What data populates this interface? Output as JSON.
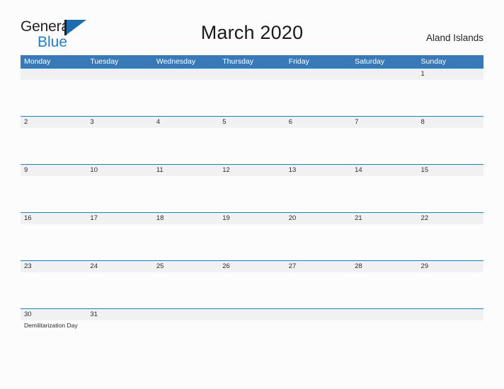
{
  "brand": {
    "name_top": "General",
    "name_bottom": "Blue",
    "triangle_color": "#1e6cb0",
    "blue_text_color": "#1b7fd4"
  },
  "header": {
    "title": "March 2020",
    "locale": "Aland Islands"
  },
  "theme": {
    "header_blue": "#3a79b8",
    "row_line_blue": "#3a79b8",
    "daynum_band_gray": "#f1f1f1",
    "page_background": "#fcfcfc"
  },
  "calendar": {
    "weekday_headers": [
      "Monday",
      "Tuesday",
      "Wednesday",
      "Thursday",
      "Friday",
      "Saturday",
      "Sunday"
    ],
    "weeks": [
      [
        {
          "day": "",
          "event": ""
        },
        {
          "day": "",
          "event": ""
        },
        {
          "day": "",
          "event": ""
        },
        {
          "day": "",
          "event": ""
        },
        {
          "day": "",
          "event": ""
        },
        {
          "day": "",
          "event": ""
        },
        {
          "day": "1",
          "event": ""
        }
      ],
      [
        {
          "day": "2",
          "event": ""
        },
        {
          "day": "3",
          "event": ""
        },
        {
          "day": "4",
          "event": ""
        },
        {
          "day": "5",
          "event": ""
        },
        {
          "day": "6",
          "event": ""
        },
        {
          "day": "7",
          "event": ""
        },
        {
          "day": "8",
          "event": ""
        }
      ],
      [
        {
          "day": "9",
          "event": ""
        },
        {
          "day": "10",
          "event": ""
        },
        {
          "day": "11",
          "event": ""
        },
        {
          "day": "12",
          "event": ""
        },
        {
          "day": "13",
          "event": ""
        },
        {
          "day": "14",
          "event": ""
        },
        {
          "day": "15",
          "event": ""
        }
      ],
      [
        {
          "day": "16",
          "event": ""
        },
        {
          "day": "17",
          "event": ""
        },
        {
          "day": "18",
          "event": ""
        },
        {
          "day": "19",
          "event": ""
        },
        {
          "day": "20",
          "event": ""
        },
        {
          "day": "21",
          "event": ""
        },
        {
          "day": "22",
          "event": ""
        }
      ],
      [
        {
          "day": "23",
          "event": ""
        },
        {
          "day": "24",
          "event": ""
        },
        {
          "day": "25",
          "event": ""
        },
        {
          "day": "26",
          "event": ""
        },
        {
          "day": "27",
          "event": ""
        },
        {
          "day": "28",
          "event": ""
        },
        {
          "day": "29",
          "event": ""
        }
      ],
      [
        {
          "day": "30",
          "event": "Demilitarization Day"
        },
        {
          "day": "31",
          "event": ""
        },
        {
          "day": "",
          "event": ""
        },
        {
          "day": "",
          "event": ""
        },
        {
          "day": "",
          "event": ""
        },
        {
          "day": "",
          "event": ""
        },
        {
          "day": "",
          "event": ""
        }
      ]
    ]
  }
}
